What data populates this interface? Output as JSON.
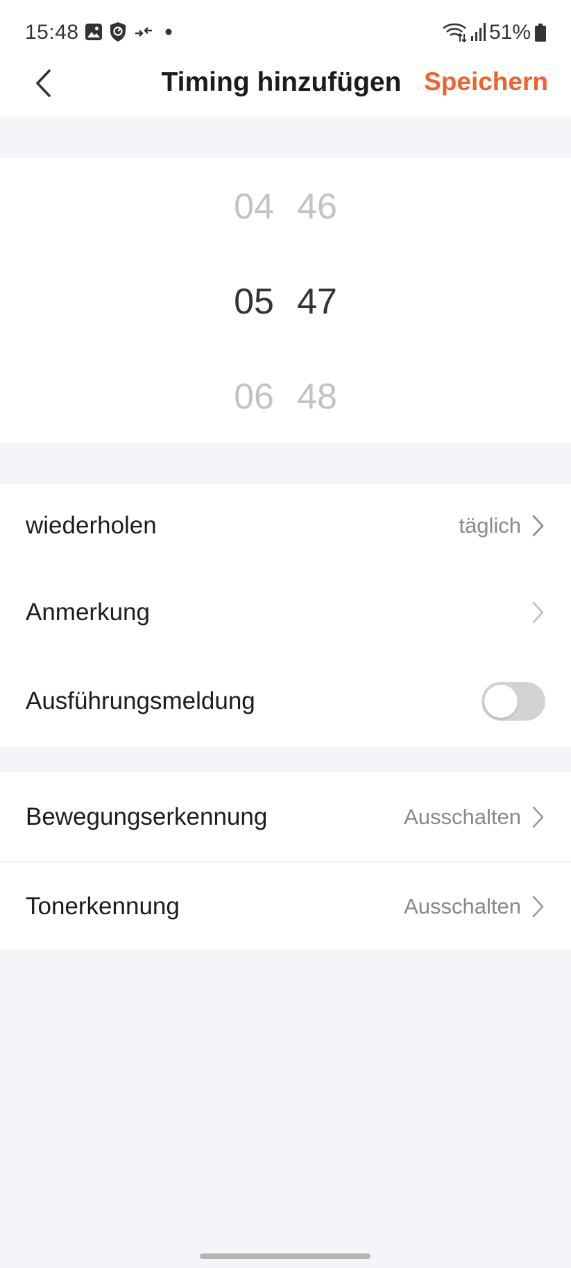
{
  "status_bar": {
    "time": "15:48",
    "battery_percent": "51%",
    "icons_left": [
      "gallery-icon",
      "shield-icon",
      "data-transfer-icon",
      "dot-icon"
    ],
    "icons_right": [
      "wifi-icon",
      "signal-icon",
      "battery-icon"
    ]
  },
  "header": {
    "title": "Timing hinzufügen",
    "save_label": "Speichern",
    "back_icon": "chevron-left-icon"
  },
  "picker": {
    "hours": [
      "04",
      "05",
      "06"
    ],
    "minutes": [
      "46",
      "47",
      "48"
    ],
    "selected_hour": "05",
    "selected_minute": "47"
  },
  "settings": {
    "repeat": {
      "label": "wiederholen",
      "value": "täglich"
    },
    "note": {
      "label": "Anmerkung",
      "value": ""
    },
    "notification": {
      "label": "Ausführungsmeldung",
      "enabled": false
    },
    "motion": {
      "label": "Bewegungserkennung",
      "value": "Ausschalten"
    },
    "sound": {
      "label": "Tonerkennung",
      "value": "Ausschalten"
    }
  },
  "colors": {
    "accent": "#f0622d",
    "background": "#f4f5f9",
    "toggle_off": "#d3d3d5"
  }
}
